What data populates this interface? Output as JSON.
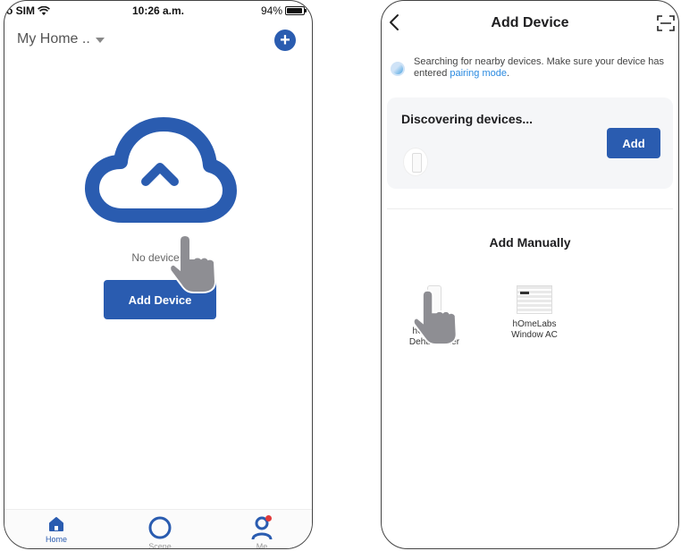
{
  "left_screen": {
    "status": {
      "carrier": "o SIM",
      "time": "10:26 a.m.",
      "battery": "94%"
    },
    "header": {
      "home_name": "My Home ..",
      "add_button": "+"
    },
    "empty_state": {
      "message": "No devices",
      "add_button_label": "Add Device"
    },
    "tabs": [
      {
        "label": "Home",
        "icon": "home-icon",
        "active": true
      },
      {
        "label": "Scene",
        "icon": "scene-icon",
        "active": false
      },
      {
        "label": "Me",
        "icon": "person-icon",
        "active": false
      }
    ],
    "colors": {
      "accent": "#2a5cb0",
      "badge": "#e03a3a"
    }
  },
  "right_screen": {
    "title": "Add Device",
    "search_text": "Searching for nearby devices. Make sure your device has entered",
    "pairing_link": "pairing mode",
    "search_suffix": ".",
    "discover": {
      "title": "Discovering devices...",
      "add_label": "Add"
    },
    "manual_title": "Add Manually",
    "manual_items": [
      {
        "line1": "hOmeLabs",
        "line2": "Dehumidifier"
      },
      {
        "line1": "hOmeLabs",
        "line2": "Window AC"
      }
    ],
    "colors": {
      "accent": "#2a5cb0",
      "link": "#2b8ae0"
    }
  }
}
